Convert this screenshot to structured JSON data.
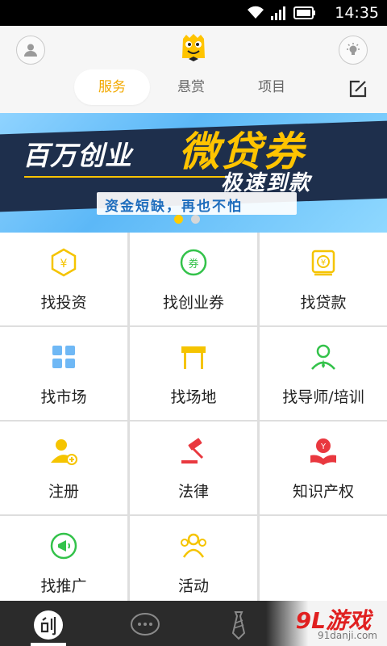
{
  "status_bar": {
    "time": "14:35"
  },
  "header": {
    "tabs": [
      {
        "label": "服务",
        "active": true
      },
      {
        "label": "悬赏",
        "active": false
      },
      {
        "label": "项目",
        "active": false
      }
    ],
    "accent_color": "#f2a900"
  },
  "banner": {
    "line1": "百万创业",
    "line2": "微贷券",
    "line3": "极速到款",
    "line4": "资金短缺，再也不怕",
    "slide_count": 2,
    "active_slide": 1
  },
  "services": [
    {
      "label": "找投资",
      "icon": "investment-icon"
    },
    {
      "label": "找创业券",
      "icon": "coupon-icon"
    },
    {
      "label": "找贷款",
      "icon": "loan-icon"
    },
    {
      "label": "找市场",
      "icon": "market-icon"
    },
    {
      "label": "找场地",
      "icon": "venue-icon"
    },
    {
      "label": "找导师/培训",
      "icon": "mentor-icon"
    },
    {
      "label": "注册",
      "icon": "register-icon"
    },
    {
      "label": "法律",
      "icon": "law-icon"
    },
    {
      "label": "知识产权",
      "icon": "ip-icon"
    },
    {
      "label": "找推广",
      "icon": "promotion-icon"
    },
    {
      "label": "活动",
      "icon": "activity-icon"
    }
  ],
  "bottom_nav": [
    {
      "icon": "create-icon",
      "active": true
    },
    {
      "icon": "chat-icon",
      "active": false
    },
    {
      "icon": "tie-icon",
      "active": false
    }
  ],
  "watermark": {
    "brand": "9L游戏",
    "url": "91danji.com"
  }
}
